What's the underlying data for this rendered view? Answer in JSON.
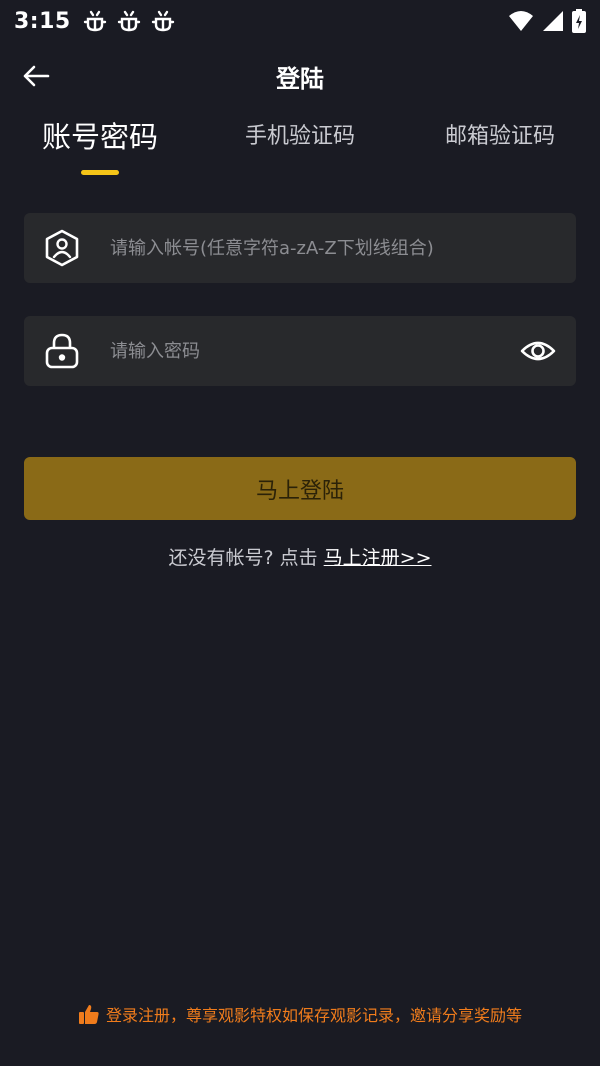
{
  "status_bar": {
    "time": "3:15",
    "notifications": [
      "bug-icon",
      "bug-icon",
      "bug-icon"
    ],
    "icons": [
      "wifi-icon",
      "signal-icon",
      "battery-icon"
    ]
  },
  "header": {
    "title": "登陆"
  },
  "tabs": [
    {
      "label": "账号密码",
      "active": true
    },
    {
      "label": "手机验证码",
      "active": false
    },
    {
      "label": "邮箱验证码",
      "active": false
    }
  ],
  "form": {
    "account_placeholder": "请输入帐号(任意字符a-zA-Z下划线组合)",
    "password_placeholder": "请输入密码",
    "submit_label": "马上登陆"
  },
  "register": {
    "prompt": "还没有帐号? 点击 ",
    "link": "马上注册>>"
  },
  "footer": {
    "text": "登录注册，尊享观影特权如保存观影记录，邀请分享奖励等"
  },
  "colors": {
    "background": "#1a1b23",
    "field_bg": "#28292c",
    "accent": "#f5c518",
    "button": "#8a6a17",
    "footer_text": "#f07c1c"
  }
}
